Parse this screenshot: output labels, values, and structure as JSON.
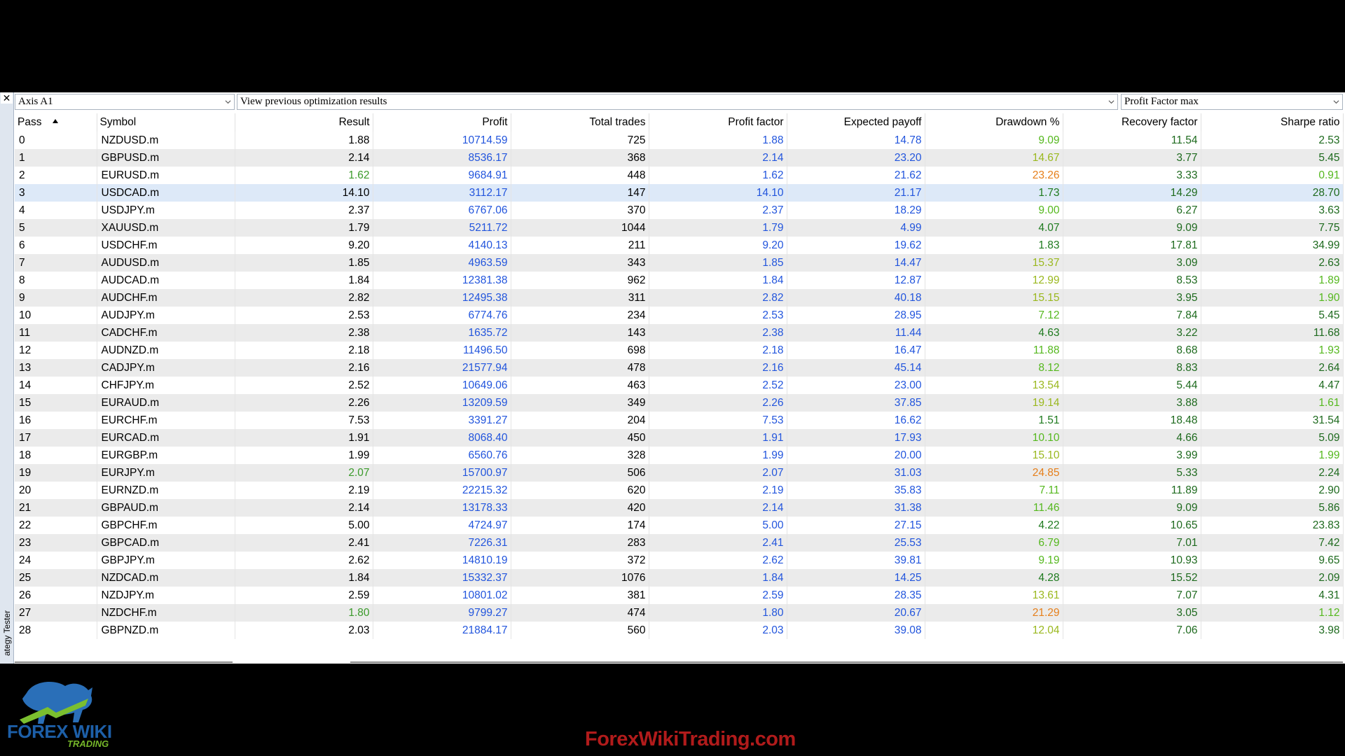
{
  "panel": {
    "close_glyph": "✕",
    "side_label": "ategy Tester",
    "expert_combo": "Axis A1",
    "results_combo": "View previous optimization results",
    "criterion_combo": "Profit Factor max"
  },
  "table": {
    "headers": [
      "Pass",
      "Symbol",
      "Result",
      "Profit",
      "Total trades",
      "Profit factor",
      "Expected payoff",
      "Drawdown %",
      "Recovery factor",
      "Sharpe ratio"
    ],
    "sort_column": "Pass",
    "selected_row": 3,
    "rows": [
      {
        "pass": "0",
        "symbol": "NZDUSD.m",
        "result": "1.88",
        "profit": "10714.59",
        "trades": "725",
        "pf": "1.88",
        "payoff": "14.78",
        "dd": "9.09",
        "rf": "11.54",
        "sharpe": "2.53"
      },
      {
        "pass": "1",
        "symbol": "GBPUSD.m",
        "result": "2.14",
        "profit": "8536.17",
        "trades": "368",
        "pf": "2.14",
        "payoff": "23.20",
        "dd": "14.67",
        "rf": "3.77",
        "sharpe": "5.45"
      },
      {
        "pass": "2",
        "symbol": "EURUSD.m",
        "result": "1.62",
        "profit": "9684.91",
        "trades": "448",
        "pf": "1.62",
        "payoff": "21.62",
        "dd": "23.26",
        "rf": "3.33",
        "sharpe": "0.91"
      },
      {
        "pass": "3",
        "symbol": "USDCAD.m",
        "result": "14.10",
        "profit": "3112.17",
        "trades": "147",
        "pf": "14.10",
        "payoff": "21.17",
        "dd": "1.73",
        "rf": "14.29",
        "sharpe": "28.70"
      },
      {
        "pass": "4",
        "symbol": "USDJPY.m",
        "result": "2.37",
        "profit": "6767.06",
        "trades": "370",
        "pf": "2.37",
        "payoff": "18.29",
        "dd": "9.00",
        "rf": "6.27",
        "sharpe": "3.63"
      },
      {
        "pass": "5",
        "symbol": "XAUUSD.m",
        "result": "1.79",
        "profit": "5211.72",
        "trades": "1044",
        "pf": "1.79",
        "payoff": "4.99",
        "dd": "4.07",
        "rf": "9.09",
        "sharpe": "7.75"
      },
      {
        "pass": "6",
        "symbol": "USDCHF.m",
        "result": "9.20",
        "profit": "4140.13",
        "trades": "211",
        "pf": "9.20",
        "payoff": "19.62",
        "dd": "1.83",
        "rf": "17.81",
        "sharpe": "34.99"
      },
      {
        "pass": "7",
        "symbol": "AUDUSD.m",
        "result": "1.85",
        "profit": "4963.59",
        "trades": "343",
        "pf": "1.85",
        "payoff": "14.47",
        "dd": "15.37",
        "rf": "3.09",
        "sharpe": "2.63"
      },
      {
        "pass": "8",
        "symbol": "AUDCAD.m",
        "result": "1.84",
        "profit": "12381.38",
        "trades": "962",
        "pf": "1.84",
        "payoff": "12.87",
        "dd": "12.99",
        "rf": "8.53",
        "sharpe": "1.89"
      },
      {
        "pass": "9",
        "symbol": "AUDCHF.m",
        "result": "2.82",
        "profit": "12495.38",
        "trades": "311",
        "pf": "2.82",
        "payoff": "40.18",
        "dd": "15.15",
        "rf": "3.95",
        "sharpe": "1.90"
      },
      {
        "pass": "10",
        "symbol": "AUDJPY.m",
        "result": "2.53",
        "profit": "6774.76",
        "trades": "234",
        "pf": "2.53",
        "payoff": "28.95",
        "dd": "7.12",
        "rf": "7.84",
        "sharpe": "5.45"
      },
      {
        "pass": "11",
        "symbol": "CADCHF.m",
        "result": "2.38",
        "profit": "1635.72",
        "trades": "143",
        "pf": "2.38",
        "payoff": "11.44",
        "dd": "4.63",
        "rf": "3.22",
        "sharpe": "11.68"
      },
      {
        "pass": "12",
        "symbol": "AUDNZD.m",
        "result": "2.18",
        "profit": "11496.50",
        "trades": "698",
        "pf": "2.18",
        "payoff": "16.47",
        "dd": "11.88",
        "rf": "8.68",
        "sharpe": "1.93"
      },
      {
        "pass": "13",
        "symbol": "CADJPY.m",
        "result": "2.16",
        "profit": "21577.94",
        "trades": "478",
        "pf": "2.16",
        "payoff": "45.14",
        "dd": "8.12",
        "rf": "8.83",
        "sharpe": "2.64"
      },
      {
        "pass": "14",
        "symbol": "CHFJPY.m",
        "result": "2.52",
        "profit": "10649.06",
        "trades": "463",
        "pf": "2.52",
        "payoff": "23.00",
        "dd": "13.54",
        "rf": "5.44",
        "sharpe": "4.47"
      },
      {
        "pass": "15",
        "symbol": "EURAUD.m",
        "result": "2.26",
        "profit": "13209.59",
        "trades": "349",
        "pf": "2.26",
        "payoff": "37.85",
        "dd": "19.14",
        "rf": "3.88",
        "sharpe": "1.61"
      },
      {
        "pass": "16",
        "symbol": "EURCHF.m",
        "result": "7.53",
        "profit": "3391.27",
        "trades": "204",
        "pf": "7.53",
        "payoff": "16.62",
        "dd": "1.51",
        "rf": "18.48",
        "sharpe": "31.54"
      },
      {
        "pass": "17",
        "symbol": "EURCAD.m",
        "result": "1.91",
        "profit": "8068.40",
        "trades": "450",
        "pf": "1.91",
        "payoff": "17.93",
        "dd": "10.10",
        "rf": "4.66",
        "sharpe": "5.09"
      },
      {
        "pass": "18",
        "symbol": "EURGBP.m",
        "result": "1.99",
        "profit": "6560.76",
        "trades": "328",
        "pf": "1.99",
        "payoff": "20.00",
        "dd": "15.10",
        "rf": "3.99",
        "sharpe": "1.99"
      },
      {
        "pass": "19",
        "symbol": "EURJPY.m",
        "result": "2.07",
        "profit": "15700.97",
        "trades": "506",
        "pf": "2.07",
        "payoff": "31.03",
        "dd": "24.85",
        "rf": "5.33",
        "sharpe": "2.24"
      },
      {
        "pass": "20",
        "symbol": "EURNZD.m",
        "result": "2.19",
        "profit": "22215.32",
        "trades": "620",
        "pf": "2.19",
        "payoff": "35.83",
        "dd": "7.11",
        "rf": "11.89",
        "sharpe": "2.90"
      },
      {
        "pass": "21",
        "symbol": "GBPAUD.m",
        "result": "2.14",
        "profit": "13178.33",
        "trades": "420",
        "pf": "2.14",
        "payoff": "31.38",
        "dd": "11.46",
        "rf": "9.09",
        "sharpe": "5.86"
      },
      {
        "pass": "22",
        "symbol": "GBPCHF.m",
        "result": "5.00",
        "profit": "4724.97",
        "trades": "174",
        "pf": "5.00",
        "payoff": "27.15",
        "dd": "4.22",
        "rf": "10.65",
        "sharpe": "23.83"
      },
      {
        "pass": "23",
        "symbol": "GBPCAD.m",
        "result": "2.41",
        "profit": "7226.31",
        "trades": "283",
        "pf": "2.41",
        "payoff": "25.53",
        "dd": "6.79",
        "rf": "7.01",
        "sharpe": "7.42"
      },
      {
        "pass": "24",
        "symbol": "GBPJPY.m",
        "result": "2.62",
        "profit": "14810.19",
        "trades": "372",
        "pf": "2.62",
        "payoff": "39.81",
        "dd": "9.19",
        "rf": "10.93",
        "sharpe": "9.65"
      },
      {
        "pass": "25",
        "symbol": "NZDCAD.m",
        "result": "1.84",
        "profit": "15332.37",
        "trades": "1076",
        "pf": "1.84",
        "payoff": "14.25",
        "dd": "4.28",
        "rf": "15.52",
        "sharpe": "2.09"
      },
      {
        "pass": "26",
        "symbol": "NZDJPY.m",
        "result": "2.59",
        "profit": "10801.02",
        "trades": "381",
        "pf": "2.59",
        "payoff": "28.35",
        "dd": "13.61",
        "rf": "7.07",
        "sharpe": "4.31"
      },
      {
        "pass": "27",
        "symbol": "NZDCHF.m",
        "result": "1.80",
        "profit": "9799.27",
        "trades": "474",
        "pf": "1.80",
        "payoff": "20.67",
        "dd": "21.29",
        "rf": "3.05",
        "sharpe": "1.12"
      },
      {
        "pass": "28",
        "symbol": "GBPNZD.m",
        "result": "2.03",
        "profit": "21884.17",
        "trades": "560",
        "pf": "2.03",
        "payoff": "39.08",
        "dd": "12.04",
        "rf": "7.06",
        "sharpe": "3.98"
      }
    ]
  },
  "colors": {
    "profit": "#2255dd",
    "pf": "#2255dd",
    "payoff": "#2255dd",
    "result_green": "#3a9a2a",
    "dd_low": "#1e7a1e",
    "dd_mid_green": "#55b81e",
    "dd_yellow": "#9ab81e",
    "dd_orange": "#e67f1a",
    "rf": "#1e6a1e",
    "sharpe_dark": "#1e6a1e",
    "sharpe_light": "#55b81e"
  },
  "branding": {
    "logo_text": "FOREX WIKI",
    "logo_sub": "TRADING",
    "watermark": "ForexWikiTrading.com"
  }
}
